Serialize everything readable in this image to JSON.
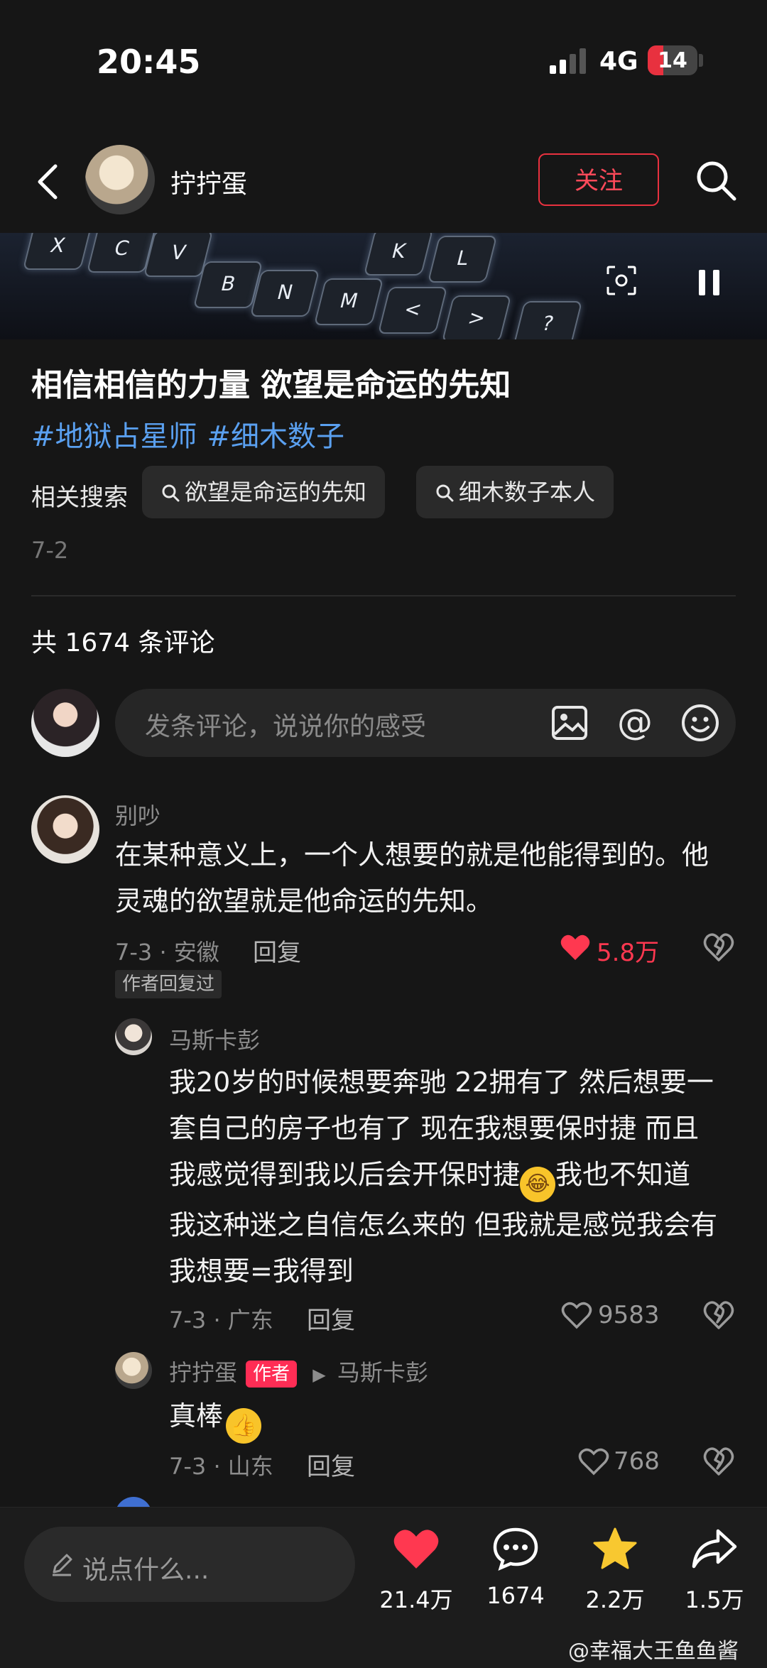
{
  "status": {
    "time": "20:45",
    "network": "4G",
    "battery": "14"
  },
  "header": {
    "author_name": "拧拧蛋",
    "follow_label": "关注"
  },
  "video": {
    "keys": [
      "X",
      "C",
      "V",
      "B",
      "N",
      "M",
      "K",
      "L",
      "<",
      ">",
      "?"
    ]
  },
  "post": {
    "title": "相信相信的力量 欲望是命运的先知",
    "tags": [
      "#地狱占星师",
      "#细木数子"
    ],
    "related_label": "相关搜索",
    "related_chips": [
      "欲望是命运的先知",
      "细木数子本人"
    ],
    "date": "7-2"
  },
  "comments_header": {
    "count_text": "共 1674 条评论"
  },
  "comment_input": {
    "placeholder": "发条评论，说说你的感受"
  },
  "comments": [
    {
      "user": "别吵",
      "text_lines": [
        "在某种意义上，一个人想要的就是他能得到的。他",
        "灵魂的欲望就是他命运的先知。"
      ],
      "meta": "7-3 · 安徽",
      "reply": "回复",
      "likes": "5.8万",
      "liked": true,
      "badge": "作者回复过"
    }
  ],
  "replies": [
    {
      "user": "马斯卡彭",
      "text_lines": [
        "我20岁的时候想要奔驰 22拥有了 然后想要一",
        "套自己的房子也有了 现在我想要保时捷 而且",
        "我感觉得到我以后会开保时捷",
        "我也不知道",
        "我这种迷之自信怎么来的 但我就是感觉我会有",
        "我想要=我得到"
      ],
      "meta": "7-3 · 广东",
      "reply": "回复",
      "likes": "9583"
    },
    {
      "user": "拧拧蛋",
      "author_badge": "作者",
      "reply_to": "马斯卡彭",
      "text": "真棒",
      "meta": "7-3 · 山东",
      "reply": "回复",
      "likes": "768"
    }
  ],
  "bottom": {
    "say_placeholder": "说点什么...",
    "likes": "21.4万",
    "comments": "1674",
    "favorites": "2.2万",
    "shares": "1.5万"
  },
  "watermark": "@幸福大王鱼鱼酱",
  "colors": {
    "accent": "#ff2d55",
    "tag": "#5aa0f0",
    "background": "#161616"
  }
}
